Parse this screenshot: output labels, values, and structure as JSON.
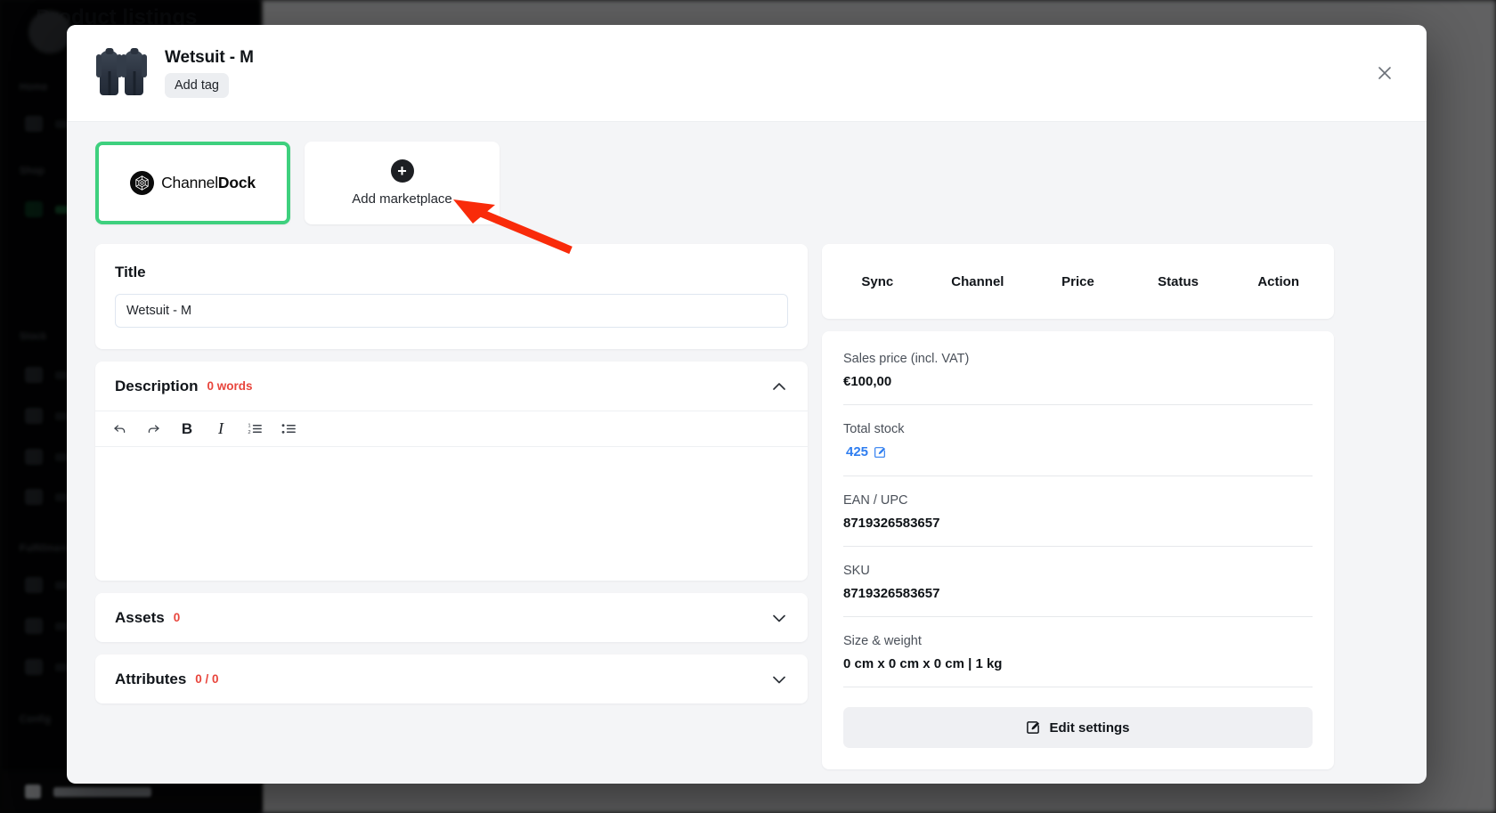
{
  "background": {
    "page_title": "Product listings",
    "sidebar_sections": [
      "Home",
      "Shop",
      "Stock",
      "Fulfillment",
      "Config"
    ],
    "bottom_item": "Integrations"
  },
  "modal": {
    "header": {
      "product_title": "Wetsuit - M",
      "add_tag_label": "Add tag",
      "thumbnail_icon": "wetsuit-image",
      "close_icon": "close-icon"
    },
    "marketplaces": [
      {
        "name": "ChannelDock",
        "name_prefix": "Channel",
        "name_suffix": "Dock",
        "selected": true,
        "logo_icon": "channeldock-logo-icon"
      },
      {
        "name": "Add marketplace",
        "selected": false,
        "icon": "plus-circle-icon"
      }
    ],
    "left": {
      "title_section": {
        "label": "Title",
        "value": "Wetsuit - M",
        "placeholder": "Title"
      },
      "description_section": {
        "label": "Description",
        "count": "0 words",
        "expanded": true,
        "chevron_icon": "chevron-up-icon",
        "editor_content": "",
        "editor_placeholder": "",
        "toolbar": [
          {
            "name": "undo-icon",
            "label": "Undo"
          },
          {
            "name": "redo-icon",
            "label": "Redo"
          },
          {
            "name": "bold-icon",
            "label": "B"
          },
          {
            "name": "italic-icon",
            "label": "I"
          },
          {
            "name": "ordered-list-icon",
            "label": "Ordered list"
          },
          {
            "name": "bullet-list-icon",
            "label": "Bullet list"
          }
        ]
      },
      "assets_section": {
        "label": "Assets",
        "count": "0",
        "expanded": false,
        "chevron_icon": "chevron-down-icon"
      },
      "attributes_section": {
        "label": "Attributes",
        "count": "0 / 0",
        "expanded": false,
        "chevron_icon": "chevron-down-icon"
      }
    },
    "right": {
      "channel_table_headers": [
        "Sync",
        "Channel",
        "Price",
        "Status",
        "Action"
      ],
      "details": [
        {
          "label": "Sales price (incl. VAT)",
          "value": "€100,00"
        },
        {
          "label": "Total stock",
          "value": "425",
          "link": true,
          "edit_icon": "edit-pencil-icon"
        },
        {
          "label": "EAN / UPC",
          "value": "8719326583657"
        },
        {
          "label": "SKU",
          "value": "8719326583657"
        },
        {
          "label": "Size & weight",
          "value": "0 cm x 0 cm x 0 cm | 1 kg"
        }
      ],
      "edit_settings_label": "Edit settings",
      "edit_settings_icon": "edit-pencil-icon"
    }
  },
  "annotation": {
    "arrow_color": "#f92b0a",
    "points_to": "Add marketplace"
  },
  "colors": {
    "accent_green": "#3ed07e",
    "link_blue": "#2f7ef0",
    "count_red": "#e8453c",
    "modal_bg": "#f4f5f7"
  }
}
